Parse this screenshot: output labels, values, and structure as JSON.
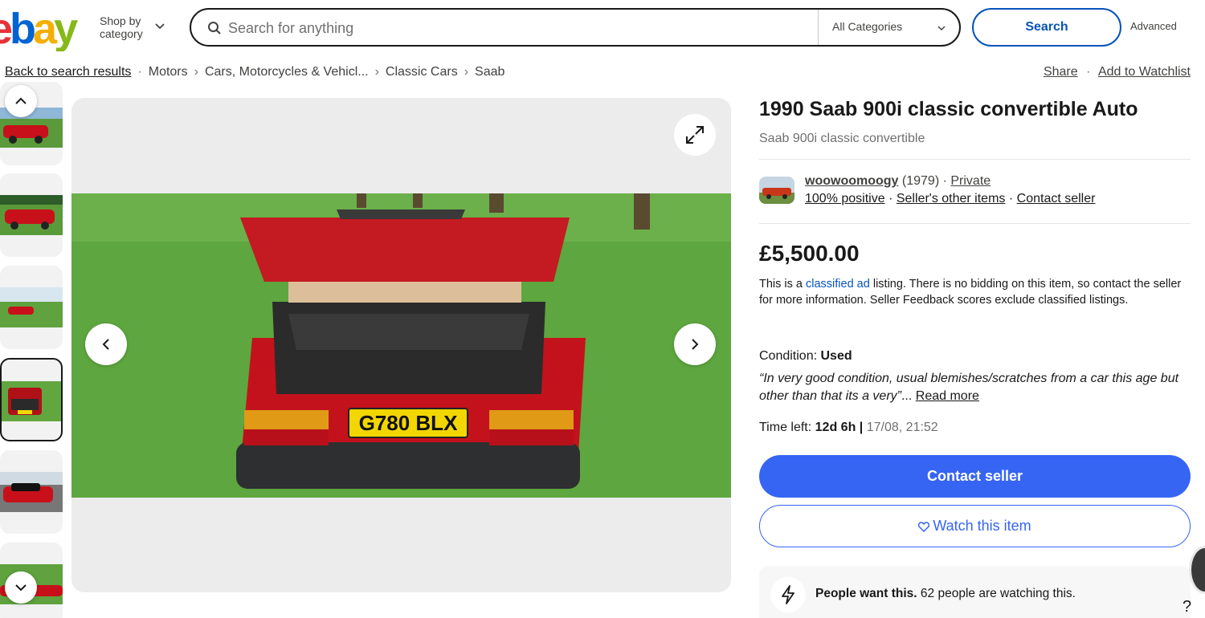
{
  "header": {
    "logo": "ebay",
    "shop_by_category": "Shop by category",
    "search_placeholder": "Search for anything",
    "category_select": "All Categories",
    "search_button": "Search",
    "advanced_link": "Advanced"
  },
  "breadcrumb": {
    "back": "Back to search results",
    "items": [
      "Motors",
      "Cars, Motorcycles & Vehicl...",
      "Classic Cars",
      "Saab"
    ],
    "share": "Share",
    "watchlist": "Add to Watchlist"
  },
  "listing": {
    "title": "1990 Saab 900i classic convertible Auto",
    "subtitle": "Saab 900i classic convertible",
    "plate": "G780 BLX"
  },
  "seller": {
    "name": "woowoomoogy",
    "score": "(1979)",
    "type": "Private",
    "feedback": "100% positive",
    "other_items": "Seller's other items",
    "contact": "Contact seller"
  },
  "price": {
    "amount": "£5,500.00",
    "note_prefix": "This is a ",
    "note_link": "classified ad",
    "note_suffix": " listing. There is no bidding on this item, so contact the seller for more information. Seller Feedback scores exclude classified listings."
  },
  "condition": {
    "label": "Condition:",
    "value": "Used",
    "quote": "“In very good condition, usual blemishes/scratches from a car this age but other than that its a very”",
    "ellipsis": "...",
    "read_more": "Read more"
  },
  "time_left": {
    "label": "Time left:",
    "value": "12d 6h",
    "separator": "|",
    "end": "17/08, 21:52"
  },
  "actions": {
    "contact_seller": "Contact seller",
    "watch_item": "Watch this item"
  },
  "popularity": {
    "bold": "People want this.",
    "text": "62 people are watching this."
  },
  "help": "?"
}
